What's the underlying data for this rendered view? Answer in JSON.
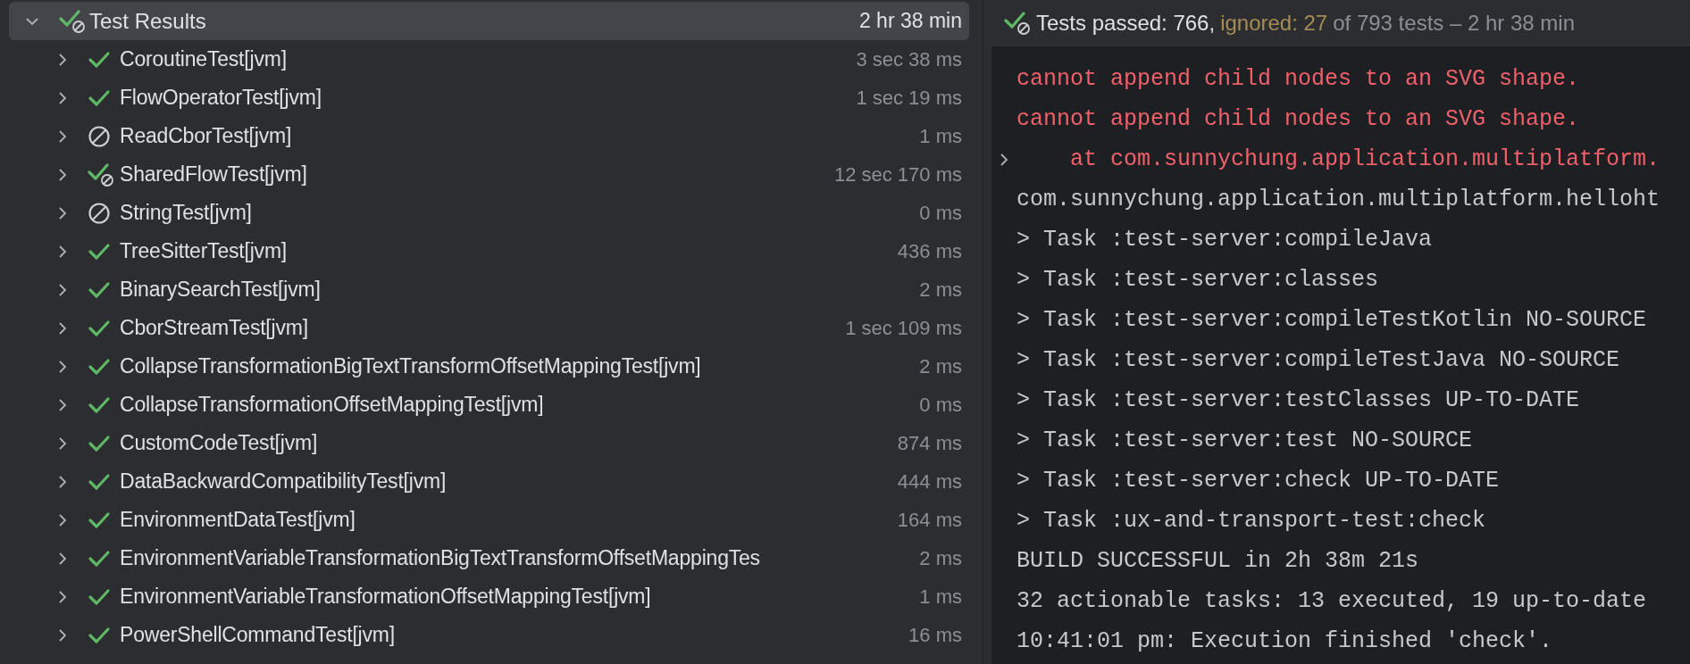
{
  "test_tree": {
    "root": {
      "label": "Test Results",
      "duration": "2 hr 38 min",
      "kind": "passed_with_ignored",
      "selected": true,
      "expanded": true
    },
    "items": [
      {
        "label": "CoroutineTest[jvm]",
        "duration": "3 sec 38 ms",
        "kind": "passed",
        "expanded": false
      },
      {
        "label": "FlowOperatorTest[jvm]",
        "duration": "1 sec 19 ms",
        "kind": "passed",
        "expanded": false
      },
      {
        "label": "ReadCborTest[jvm]",
        "duration": "1 ms",
        "kind": "ignored",
        "expanded": false
      },
      {
        "label": "SharedFlowTest[jvm]",
        "duration": "12 sec 170 ms",
        "kind": "passed_with_ignored",
        "expanded": false
      },
      {
        "label": "StringTest[jvm]",
        "duration": "0 ms",
        "kind": "ignored",
        "expanded": false
      },
      {
        "label": "TreeSitterTest[jvm]",
        "duration": "436 ms",
        "kind": "passed",
        "expanded": false
      },
      {
        "label": "BinarySearchTest[jvm]",
        "duration": "2 ms",
        "kind": "passed",
        "expanded": false
      },
      {
        "label": "CborStreamTest[jvm]",
        "duration": "1 sec 109 ms",
        "kind": "passed",
        "expanded": false
      },
      {
        "label": "CollapseTransformationBigTextTransformOffsetMappingTest[jvm]",
        "duration": "2 ms",
        "kind": "passed",
        "expanded": false
      },
      {
        "label": "CollapseTransformationOffsetMappingTest[jvm]",
        "duration": "0 ms",
        "kind": "passed",
        "expanded": false
      },
      {
        "label": "CustomCodeTest[jvm]",
        "duration": "874 ms",
        "kind": "passed",
        "expanded": false
      },
      {
        "label": "DataBackwardCompatibilityTest[jvm]",
        "duration": "444 ms",
        "kind": "passed",
        "expanded": false
      },
      {
        "label": "EnvironmentDataTest[jvm]",
        "duration": "164 ms",
        "kind": "passed",
        "expanded": false
      },
      {
        "label": "EnvironmentVariableTransformationBigTextTransformOffsetMappingTes",
        "duration": "2 ms",
        "kind": "passed",
        "expanded": false
      },
      {
        "label": "EnvironmentVariableTransformationOffsetMappingTest[jvm]",
        "duration": "1 ms",
        "kind": "passed",
        "expanded": false
      },
      {
        "label": "PowerShellCommandTest[jvm]",
        "duration": "16 ms",
        "kind": "passed",
        "expanded": false
      }
    ]
  },
  "summary": {
    "kind": "passed_with_ignored",
    "parts": [
      {
        "kind": "passed",
        "text": "Tests passed: 766,"
      },
      {
        "kind": "ignored",
        "text": "ignored: 27"
      },
      {
        "kind": "total",
        "text": "of 793 tests – 2 hr 38 min"
      }
    ]
  },
  "console": [
    {
      "kind": "error",
      "text": "cannot append child nodes to an SVG shape."
    },
    {
      "kind": "error",
      "text": "cannot append child nodes to an SVG shape."
    },
    {
      "kind": "error_trace",
      "text": "at com.sunnychung.application.multiplatform.",
      "expanded": false
    },
    {
      "kind": "output",
      "text": "com.sunnychung.application.multiplatform.helloht"
    },
    {
      "kind": "output",
      "text": "> Task :test-server:compileJava"
    },
    {
      "kind": "output",
      "text": "> Task :test-server:classes"
    },
    {
      "kind": "output",
      "text": "> Task :test-server:compileTestKotlin NO-SOURCE"
    },
    {
      "kind": "output",
      "text": "> Task :test-server:compileTestJava NO-SOURCE"
    },
    {
      "kind": "output",
      "text": "> Task :test-server:testClasses UP-TO-DATE"
    },
    {
      "kind": "output",
      "text": "> Task :test-server:test NO-SOURCE"
    },
    {
      "kind": "output",
      "text": "> Task :test-server:check UP-TO-DATE"
    },
    {
      "kind": "output",
      "text": "> Task :ux-and-transport-test:check"
    },
    {
      "kind": "output",
      "text": "BUILD SUCCESSFUL in 2h 38m 21s"
    },
    {
      "kind": "output",
      "text": "32 actionable tasks: 13 executed, 19 up-to-date"
    },
    {
      "kind": "output",
      "text": "10:41:01 pm: Execution finished 'check'."
    }
  ]
}
